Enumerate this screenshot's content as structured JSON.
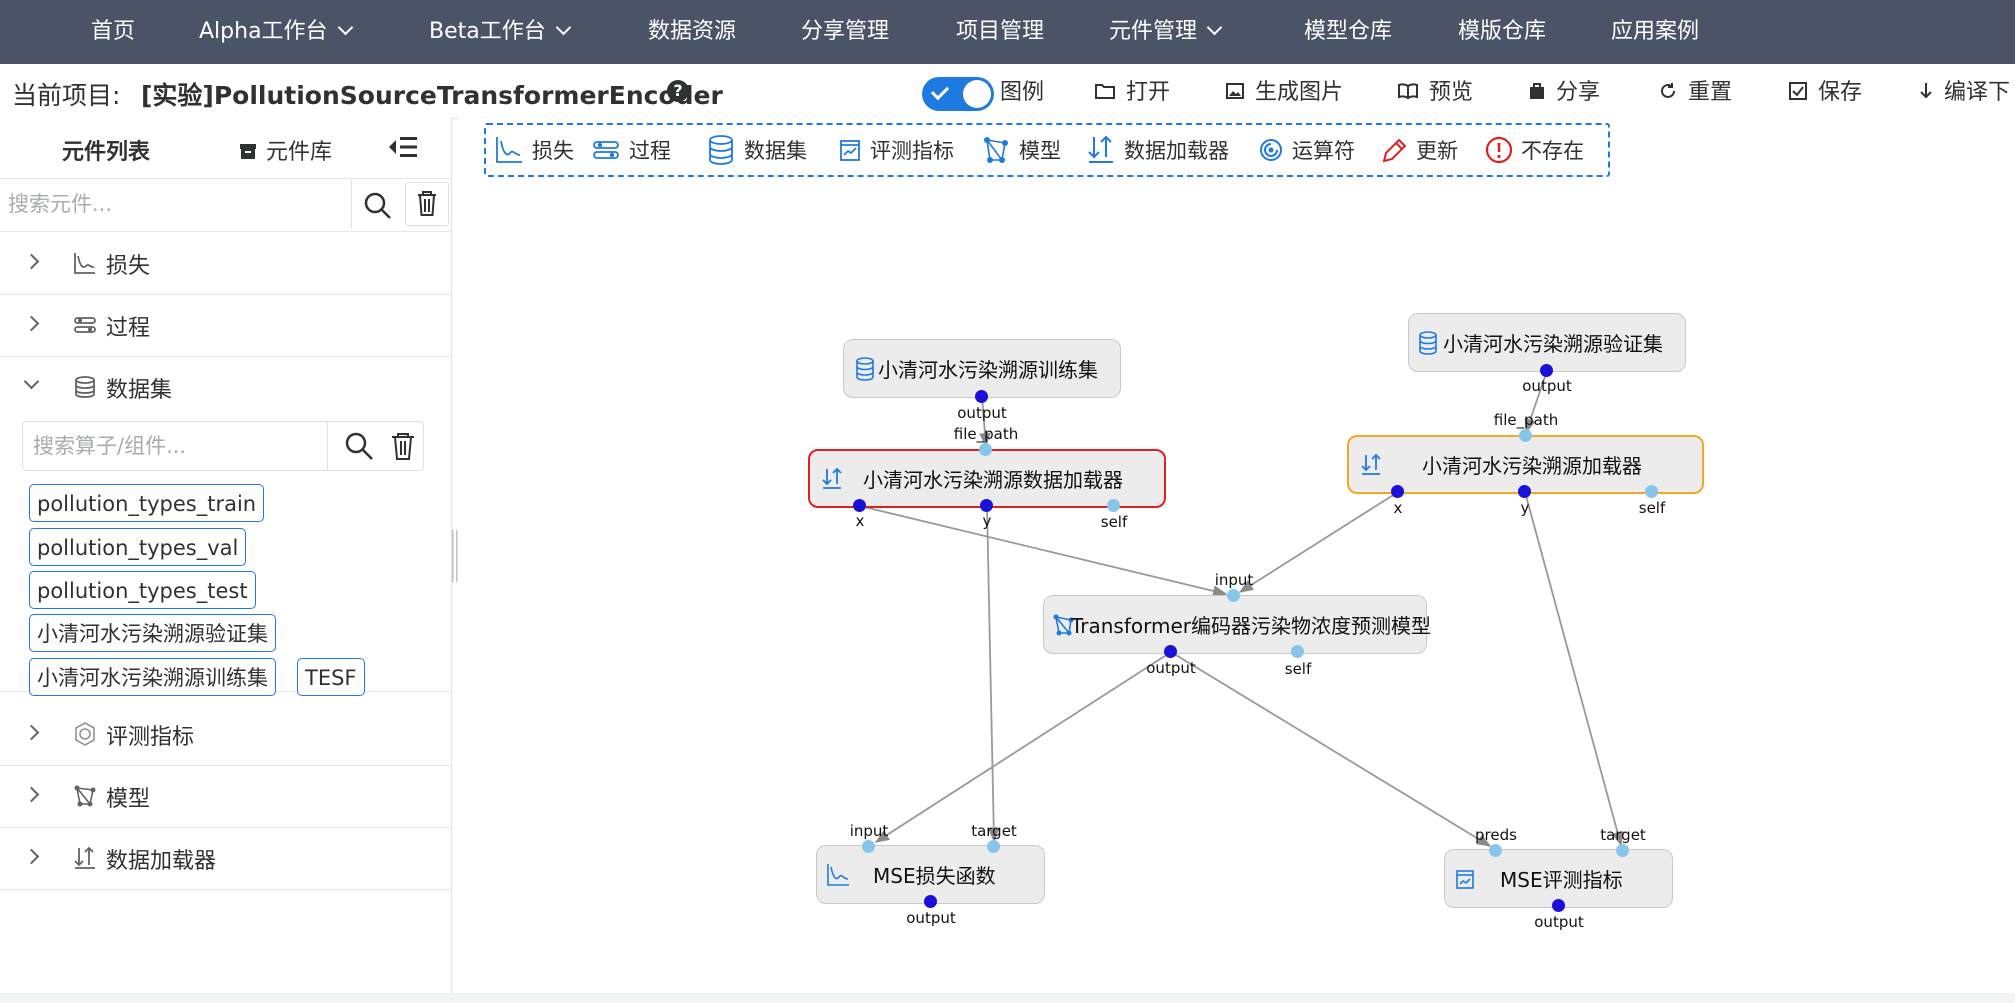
{
  "nav": {
    "items": [
      {
        "label": "首页",
        "dropdown": false
      },
      {
        "label": "Alpha工作台",
        "dropdown": true
      },
      {
        "label": "Beta工作台",
        "dropdown": true
      },
      {
        "label": "数据资源",
        "dropdown": false
      },
      {
        "label": "分享管理",
        "dropdown": false
      },
      {
        "label": "项目管理",
        "dropdown": false
      },
      {
        "label": "元件管理",
        "dropdown": true
      },
      {
        "label": "模型仓库",
        "dropdown": false
      },
      {
        "label": "模版仓库",
        "dropdown": false
      },
      {
        "label": "应用案例",
        "dropdown": false
      }
    ]
  },
  "project": {
    "label": "当前项目:",
    "name": "[实验]PollutionSourceTransformerEncoder",
    "help_icon": "question-circle-icon"
  },
  "toolbar": {
    "legend_toggle": {
      "label": "图例",
      "on": true
    },
    "open": "打开",
    "generate_image": "生成图片",
    "preview": "预览",
    "share": "分享",
    "reset": "重置",
    "save": "保存",
    "compile": "编译下"
  },
  "sidebar": {
    "title": "元件列表",
    "library": "元件库",
    "search_placeholder": "搜索元件...",
    "categories": [
      {
        "label": "损失",
        "expanded": false,
        "icon": "loss-chart-icon"
      },
      {
        "label": "过程",
        "expanded": false,
        "icon": "process-icon"
      },
      {
        "label": "数据集",
        "expanded": true,
        "icon": "database-icon"
      },
      {
        "label": "评测指标",
        "expanded": false,
        "icon": "metric-icon"
      },
      {
        "label": "模型",
        "expanded": false,
        "icon": "model-graph-icon"
      },
      {
        "label": "数据加载器",
        "expanded": false,
        "icon": "dataloader-icon"
      }
    ],
    "dataset_search_placeholder": "搜索算子/组件...",
    "dataset_tags": [
      "pollution_types_train",
      "pollution_types_val",
      "pollution_types_test",
      "小清河水污染溯源验证集",
      "小清河水污染溯源训练集",
      "TESF"
    ]
  },
  "legend": {
    "items": [
      {
        "label": "损失",
        "icon": "loss-chart-icon"
      },
      {
        "label": "过程",
        "icon": "process-icon"
      },
      {
        "label": "数据集",
        "icon": "database-icon"
      },
      {
        "label": "评测指标",
        "icon": "metric-icon"
      },
      {
        "label": "模型",
        "icon": "model-graph-icon"
      },
      {
        "label": "数据加载器",
        "icon": "dataloader-icon"
      },
      {
        "label": "运算符",
        "icon": "operator-icon"
      },
      {
        "label": "更新",
        "icon": "pencil-icon"
      },
      {
        "label": "不存在",
        "icon": "alert-circle-icon"
      }
    ]
  },
  "graph": {
    "nodes": {
      "train_set": {
        "label": "小清河水污染溯源训练集",
        "kind": "dataset"
      },
      "val_set": {
        "label": "小清河水污染溯源验证集",
        "kind": "dataset"
      },
      "train_loader": {
        "label": "小清河水污染溯源数据加载器",
        "kind": "dataloader",
        "status": "missing",
        "status_color": "#e02020"
      },
      "val_loader": {
        "label": "小清河水污染溯源加载器",
        "kind": "dataloader",
        "status": "updated",
        "status_color": "#f5a623"
      },
      "model": {
        "label": "Transformer编码器污染物浓度预测模型",
        "kind": "model"
      },
      "loss": {
        "label": "MSE损失函数",
        "kind": "loss"
      },
      "metric": {
        "label": "MSE评测指标",
        "kind": "metric"
      }
    },
    "ports": {
      "output": "output",
      "file_path": "file_path",
      "x": "x",
      "y": "y",
      "self": "self",
      "input": "input",
      "target": "target",
      "preds": "preds"
    },
    "edges": [
      {
        "from": "train_set.output",
        "to": "train_loader.file_path"
      },
      {
        "from": "val_set.output",
        "to": "val_loader.file_path"
      },
      {
        "from": "train_loader.x",
        "to": "model.input"
      },
      {
        "from": "val_loader.x",
        "to": "model.input"
      },
      {
        "from": "train_loader.y",
        "to": "loss.target"
      },
      {
        "from": "model.output",
        "to": "loss.input"
      },
      {
        "from": "model.output",
        "to": "metric.preds"
      },
      {
        "from": "val_loader.y",
        "to": "metric.target"
      }
    ]
  },
  "colors": {
    "nav_bg": "#4a5466",
    "accent": "#1f7ae0",
    "port_out": "#1a10d8",
    "port_in": "#87c6ea",
    "edge": "#999999"
  }
}
